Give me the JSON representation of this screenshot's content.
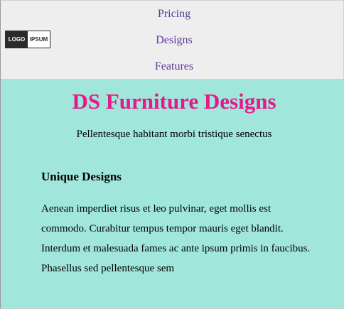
{
  "logo": {
    "left_text": "LOGO",
    "right_text": "IPSUM"
  },
  "nav": {
    "items": [
      {
        "label": "Pricing"
      },
      {
        "label": "Designs"
      },
      {
        "label": "Features"
      }
    ]
  },
  "hero": {
    "title": "DS Furniture Designs",
    "tagline": "Pellentesque habitant morbi tristique senectus",
    "section_heading": "Unique Designs",
    "body": "Aenean imperdiet risus et leo pulvinar, eget mollis est commodo. Curabitur tempus tempor mauris eget blandit. Interdum et malesuada fames ac ante ipsum primis in faucibus. Phasellus sed pellentesque sem"
  },
  "colors": {
    "header_bg": "#efeeee",
    "hero_bg": "#a0e6da",
    "title": "#e6198c",
    "nav_link": "#5a3a9c"
  }
}
